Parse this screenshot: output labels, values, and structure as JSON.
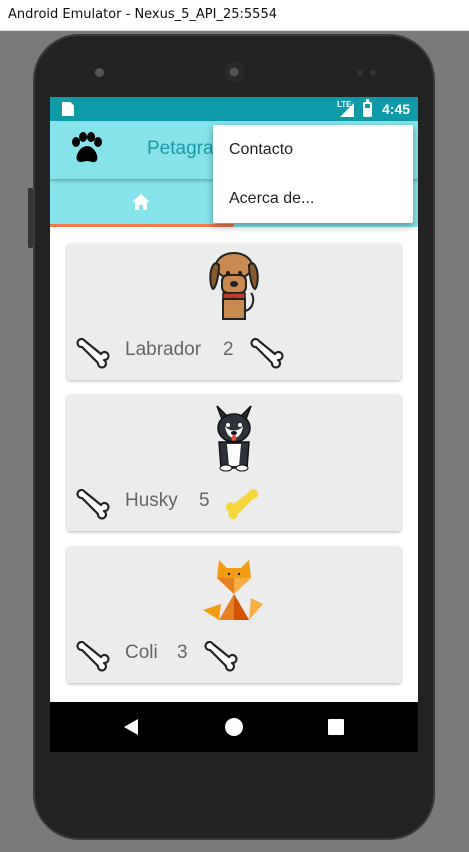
{
  "window": {
    "title": "Android Emulator - Nexus_5_API_25:5554"
  },
  "status_bar": {
    "network": "LTE",
    "time": "4:45"
  },
  "app_bar": {
    "title": "Petagram",
    "logo_icon": "paw-icon"
  },
  "tabs": [
    {
      "icon": "home-icon",
      "selected": true
    },
    {
      "icon": "",
      "selected": false
    }
  ],
  "overflow_menu": {
    "items": [
      {
        "label": "Contacto"
      },
      {
        "label": "Acerca de..."
      }
    ]
  },
  "pets": [
    {
      "name": "Labrador",
      "likes": "2",
      "image_icon": "dog-icon",
      "like_icon": "bone-outline-icon",
      "rating_icon": "bone-outline-icon",
      "rated": false
    },
    {
      "name": "Husky",
      "likes": "5",
      "image_icon": "husky-icon",
      "like_icon": "bone-outline-icon",
      "rating_icon": "bone-yellow-icon",
      "rated": true
    },
    {
      "name": "Coli",
      "likes": "3",
      "image_icon": "fox-icon",
      "like_icon": "bone-outline-icon",
      "rating_icon": "bone-outline-icon",
      "rated": false
    }
  ],
  "colors": {
    "status_bar": "#0e9aa7",
    "app_bar": "#86e3ec",
    "app_title": "#1a9aa6",
    "tab_indicator": "#f07b4b",
    "card_background": "#ececec",
    "bone_rated": "#f5d63d"
  },
  "nav_bar": {
    "buttons": [
      "back-icon",
      "home-circle-icon",
      "recents-icon"
    ]
  }
}
